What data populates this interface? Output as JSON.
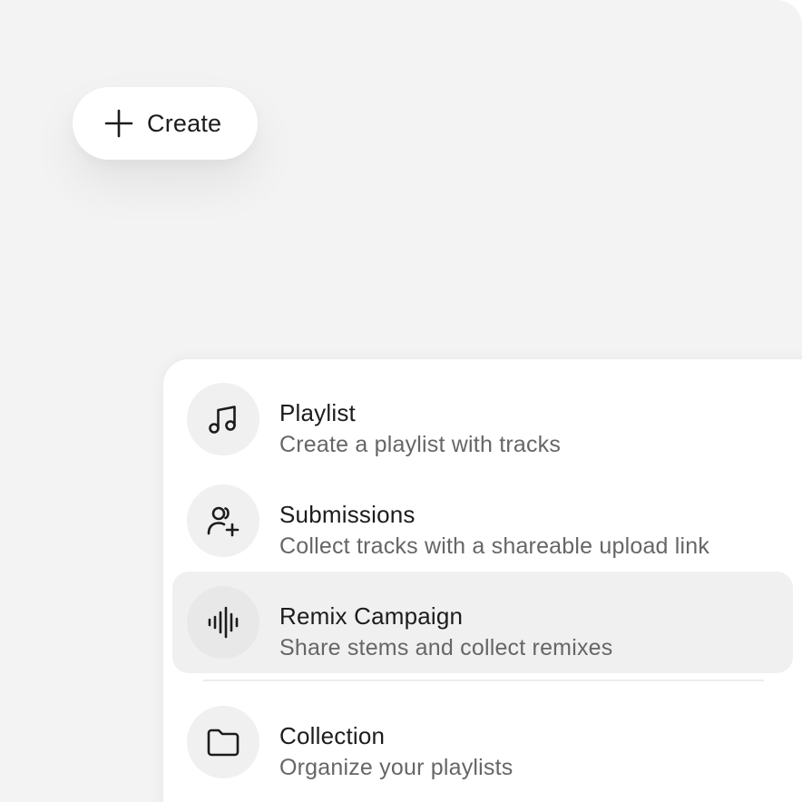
{
  "create_button": {
    "icon": "plus-icon",
    "label": "Create"
  },
  "menu": {
    "items": [
      {
        "icon": "music-note-icon",
        "title": "Playlist",
        "description": "Create a playlist with tracks",
        "active": false
      },
      {
        "icon": "user-plus-icon",
        "title": "Submissions",
        "description": "Collect tracks with a shareable upload link",
        "active": false
      },
      {
        "icon": "audio-waveform-icon",
        "title": "Remix Campaign",
        "description": "Share stems and collect remixes",
        "active": true
      },
      {
        "icon": "folder-icon",
        "title": "Collection",
        "description": "Organize your playlists",
        "active": false
      }
    ]
  },
  "colors": {
    "background": "#f3f3f3",
    "surface": "#ffffff",
    "highlight": "#f0f0f0",
    "text_primary": "#1c1c1c",
    "text_secondary": "#666666"
  }
}
